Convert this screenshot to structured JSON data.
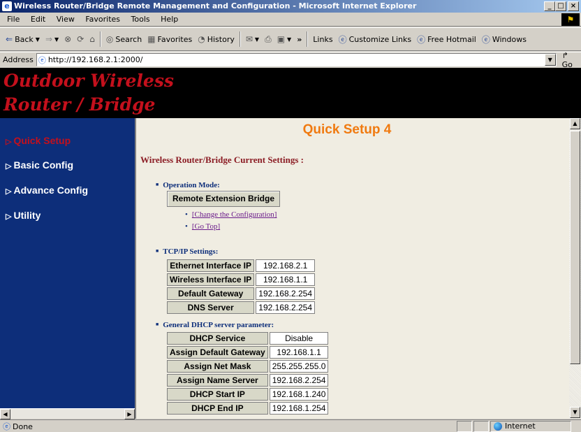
{
  "window": {
    "title": "Wireless Router/Bridge Remote Management and Configuration - Microsoft Internet Explorer",
    "minimize": "_",
    "maximize": "□",
    "close": "×"
  },
  "menu": [
    "File",
    "Edit",
    "View",
    "Favorites",
    "Tools",
    "Help"
  ],
  "toolbar": {
    "back": "Back",
    "search": "Search",
    "favorites": "Favorites",
    "history": "History",
    "chevron": "»",
    "links": "Links",
    "customize_links": "Customize Links",
    "free_hotmail": "Free Hotmail",
    "windows": "Windows"
  },
  "address": {
    "label": "Address",
    "url": "http://192.168.2.1:2000/",
    "go": "Go"
  },
  "banner": {
    "title": "Outdoor Wireless\nRouter / Bridge"
  },
  "sidebar": {
    "items": [
      {
        "label": "Quick Setup",
        "active": true
      },
      {
        "label": "Basic Config",
        "active": false
      },
      {
        "label": "Advance Config",
        "active": false
      },
      {
        "label": "Utility",
        "active": false
      }
    ]
  },
  "content": {
    "page_title": "Quick Setup 4",
    "section_heading": "Wireless Router/Bridge Current Settings :",
    "operation_mode": {
      "heading": "Operation Mode:",
      "value": "Remote Extension Bridge",
      "links": [
        "[Change the Configuration]",
        "[Go Top]"
      ]
    },
    "tcpip": {
      "heading": "TCP/IP Settings:",
      "rows": [
        {
          "key": "Ethernet Interface IP",
          "value": "192.168.2.1"
        },
        {
          "key": "Wireless Interface IP",
          "value": "192.168.1.1"
        },
        {
          "key": "Default Gateway",
          "value": "192.168.2.254"
        },
        {
          "key": "DNS Server",
          "value": "192.168.2.254"
        }
      ]
    },
    "dhcp": {
      "heading": "General DHCP server parameter:",
      "rows": [
        {
          "key": "DHCP Service",
          "value": "Disable"
        },
        {
          "key": "Assign Default Gateway",
          "value": "192.168.1.1"
        },
        {
          "key": "Assign Net Mask",
          "value": "255.255.255.0"
        },
        {
          "key": "Assign Name Server",
          "value": "192.168.2.254"
        },
        {
          "key": "DHCP Start IP",
          "value": "192.168.1.240"
        },
        {
          "key": "DHCP End IP",
          "value": "192.168.1.254"
        }
      ]
    }
  },
  "status": {
    "text": "Done",
    "zone": "Internet"
  },
  "colors": {
    "sidebar_bg": "#0d2e7a",
    "banner_bg": "#000000",
    "banner_text": "#c4101c",
    "page_title": "#f07a10",
    "content_bg": "#f0ede2"
  }
}
